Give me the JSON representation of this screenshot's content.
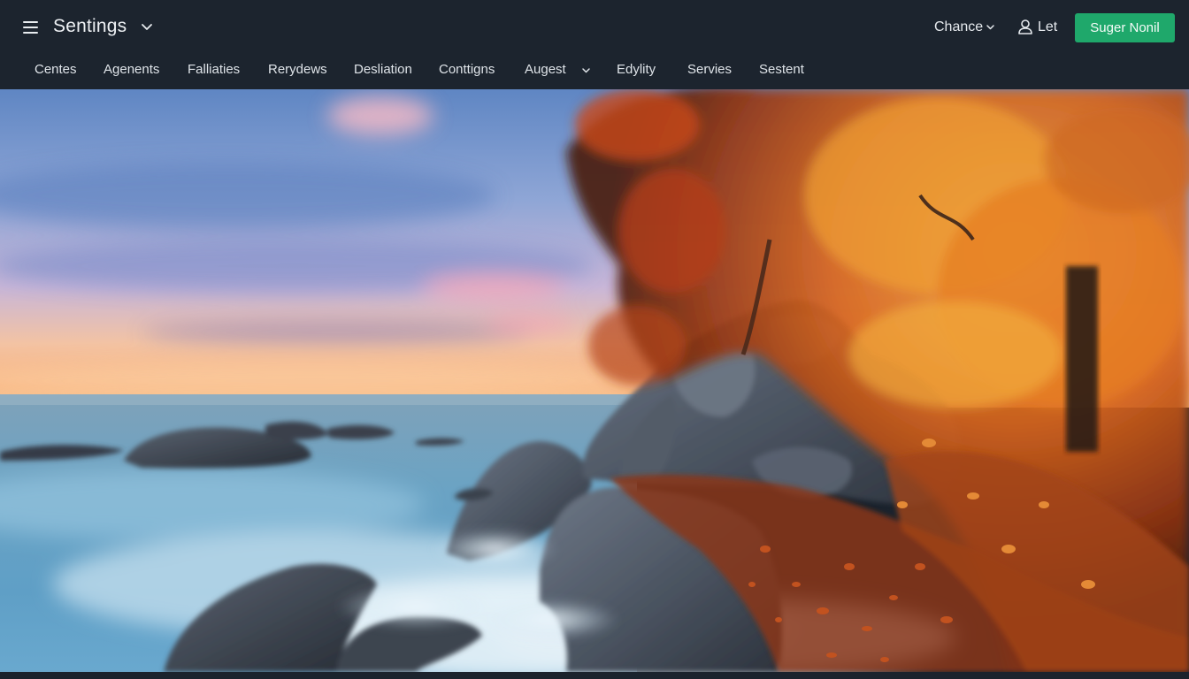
{
  "header": {
    "title": "Sentings",
    "right": {
      "dropdown_label": "Chance",
      "user_label": "Let",
      "cta_label": "Suger Nonil"
    }
  },
  "nav": {
    "items": [
      "Centes",
      "Agenents",
      "Falliaties",
      "Rerydews",
      "Desliation",
      "Conttigns",
      "Augest",
      "Edylity",
      "Servies",
      "Sestent"
    ]
  },
  "icons": {
    "menu": "hamburger-menu-icon",
    "title_dropdown": "chevron-down-icon",
    "user": "user-icon"
  },
  "colors": {
    "topbar_bg": "#1c242e",
    "cta_bg": "#1fa86b",
    "text": "#e6eaee"
  },
  "hero": {
    "image_description_hidden": ""
  }
}
